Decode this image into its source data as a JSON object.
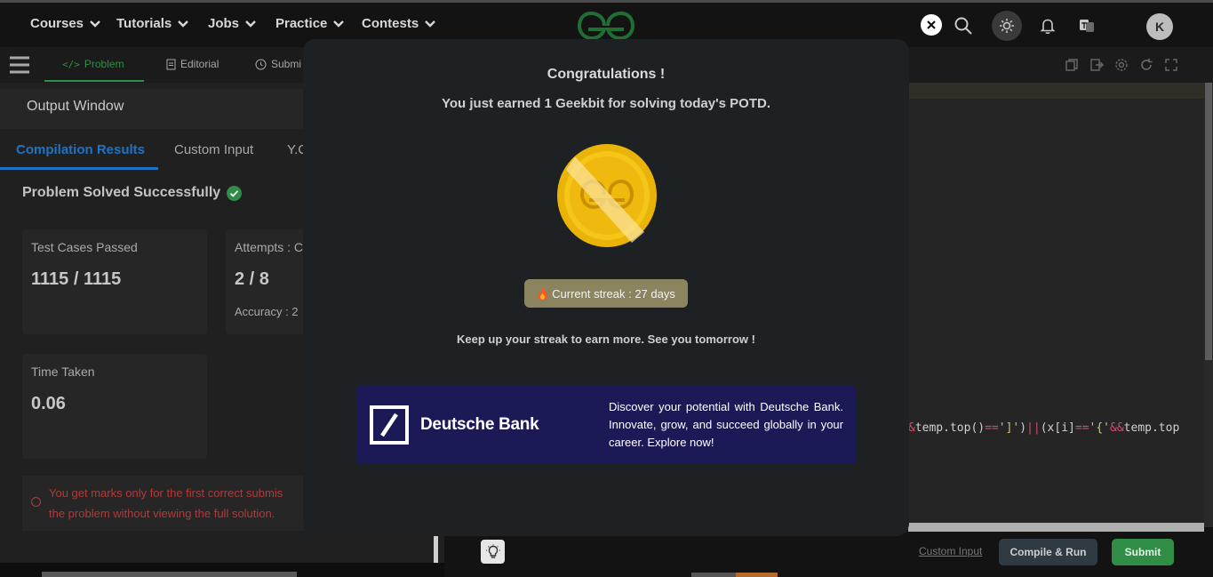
{
  "nav": {
    "items": [
      "Courses",
      "Tutorials",
      "Jobs",
      "Practice",
      "Contests"
    ],
    "avatar_letter": "K"
  },
  "subbar": {
    "tabs": [
      "Problem",
      "Editorial",
      "Submi"
    ]
  },
  "output": {
    "title": "Output Window",
    "tabs": [
      "Compilation Results",
      "Custom Input",
      "Y.C"
    ],
    "status": "Problem Solved Successfully",
    "cards": {
      "test_cases_label": "Test Cases Passed",
      "test_cases_value": "1115 / 1115",
      "attempts_label": "Attempts : C",
      "attempts_value": "2 / 8",
      "accuracy_label": "Accuracy : 2",
      "time_label": "Time Taken",
      "time_value": "0.06"
    },
    "warning_line1": "You get marks only for the first correct submis",
    "warning_line2": "the problem without viewing the full solution."
  },
  "editor": {
    "code_parts": [
      "&",
      "temp.top()",
      "==",
      "']'",
      ")",
      "||",
      "(x[i]",
      "==",
      "'{'",
      "&&",
      "temp.top"
    ]
  },
  "footer": {
    "custom_input": "Custom Input",
    "compile_run": "Compile & Run",
    "submit": "Submit"
  },
  "modal": {
    "title": "Congratulations !",
    "subtitle": "You just earned 1 Geekbit for solving today's POTD.",
    "streak": "Current streak : 27 days",
    "keep_up": "Keep up your streak to earn more. See you tomorrow !",
    "ad": {
      "brand": "Deutsche Bank",
      "text": "Discover your potential with Deutsche Bank. Innovate, grow, and succeed globally in your career. Explore now!"
    }
  },
  "colors": {
    "accent_green": "#2f8d46",
    "link_blue": "#1e74c4",
    "error_red": "#b23a3a",
    "ad_bg": "#1b1a57",
    "streak_bg": "#8a855f"
  }
}
